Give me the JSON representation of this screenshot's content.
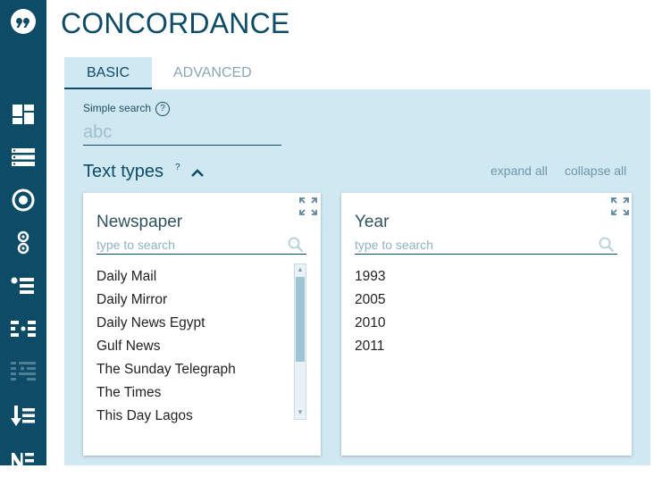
{
  "app": {
    "title": "CONCORDANCE"
  },
  "sidebar": {
    "icons": [
      "quote-logo-icon",
      "dashboard-icon",
      "list-icon",
      "target-icon",
      "filter-icon",
      "sort-icon",
      "frequency-icon",
      "collocation-icon",
      "sort-down-icon",
      "ne-icon"
    ]
  },
  "tabs": [
    {
      "label": "BASIC",
      "active": true
    },
    {
      "label": "ADVANCED",
      "active": false
    }
  ],
  "simple_search": {
    "label": "Simple search",
    "help": "?",
    "placeholder": "abc"
  },
  "text_types": {
    "title": "Text types",
    "sup": "?",
    "expand_all": "expand all",
    "collapse_all": "collapse all",
    "cards": [
      {
        "title": "Newspaper",
        "search_placeholder": "type to search",
        "items": [
          "Daily Mail",
          "Daily Mirror",
          "Daily News Egypt",
          "Gulf News",
          "The Sunday Telegraph",
          "The Times",
          "This Day Lagos"
        ]
      },
      {
        "title": "Year",
        "search_placeholder": "type to search",
        "items": [
          "1993",
          "2005",
          "2010",
          "2011"
        ]
      }
    ]
  },
  "colors": {
    "primary": "#0e4b66",
    "panel": "#cfe8f2",
    "muted": "#6f97a8"
  }
}
